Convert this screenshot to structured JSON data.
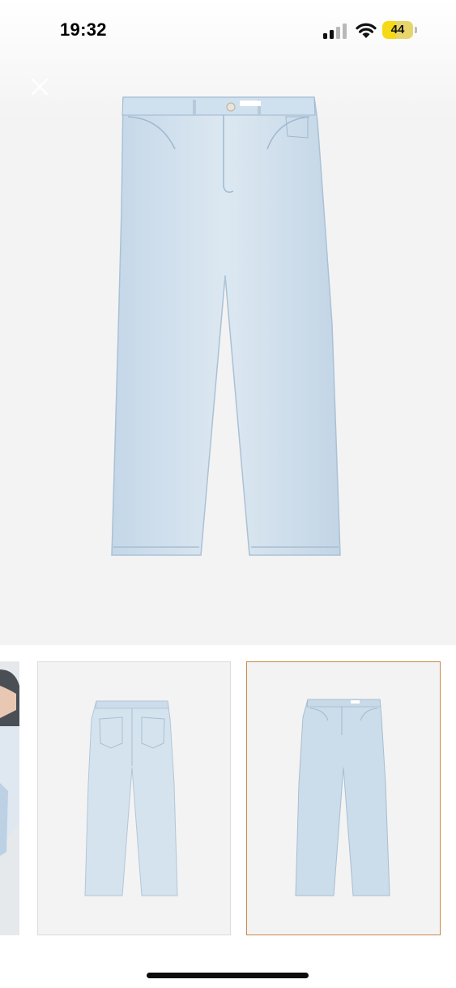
{
  "status_bar": {
    "time": "19:32",
    "battery_percent": "44",
    "battery_level": 0.44,
    "signal_icon": "cellular-signal-icon",
    "wifi_icon": "wifi-icon"
  },
  "viewer": {
    "close_icon": "close-icon",
    "main_image": "light-wash-straight-jeans-front",
    "jeans_color": "#cfe0ee"
  },
  "thumbnails": [
    {
      "image": "model-wearing-jeans-partial",
      "selected": false
    },
    {
      "image": "jeans-back-view",
      "selected": false
    },
    {
      "image": "jeans-front-view",
      "selected": true
    }
  ],
  "colors": {
    "selected_border": "#c8894a",
    "background": "#f3f3f3"
  }
}
